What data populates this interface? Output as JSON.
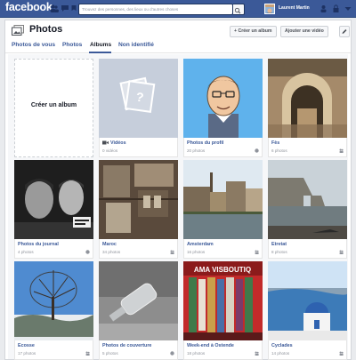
{
  "topbar": {
    "logo": "facebook",
    "search_placeholder": "Trouvez des personnes, des lieux ou d'autres choses",
    "user_name": "Laurent Martin",
    "brand_color": "#3b5998"
  },
  "header": {
    "title": "Photos",
    "create_album_label": "+ Créer un album",
    "add_video_label": "Ajouter une vidéo"
  },
  "tabs": [
    {
      "label": "Photos de vous"
    },
    {
      "label": "Photos"
    },
    {
      "label": "Albums"
    },
    {
      "label": "Non identifié"
    }
  ],
  "active_tab": "Albums",
  "create_album_card": {
    "label": "Créer un album"
  },
  "albums": [
    {
      "title": "Vidéos",
      "count": "0 vidéos",
      "thumb": "placeholder"
    },
    {
      "title": "Photos du profil",
      "count": "20 photos",
      "thumb": "cartoon-avatar"
    },
    {
      "title": "Fès",
      "count": "6 photos",
      "thumb": "moroccan-arch"
    },
    {
      "title": "Photos du journal",
      "count": "4 photos",
      "thumb": "black-white-portrait"
    },
    {
      "title": "Maroc",
      "count": "34 photos",
      "thumb": "market-stall"
    },
    {
      "title": "Amsterdam",
      "count": "16 photos",
      "thumb": "canal"
    },
    {
      "title": "Etretat",
      "count": "8 photos",
      "thumb": "cliffs"
    },
    {
      "title": "Ecosse",
      "count": "17 photos",
      "thumb": "winter-tree"
    },
    {
      "title": "Photos de couverture",
      "count": "5 photos",
      "thumb": "bottle"
    },
    {
      "title": "Week-end à Ostende",
      "count": "18 photos",
      "thumb": "market-scarves"
    },
    {
      "title": "Cyclades",
      "count": "14 photos",
      "thumb": "santorini"
    }
  ]
}
